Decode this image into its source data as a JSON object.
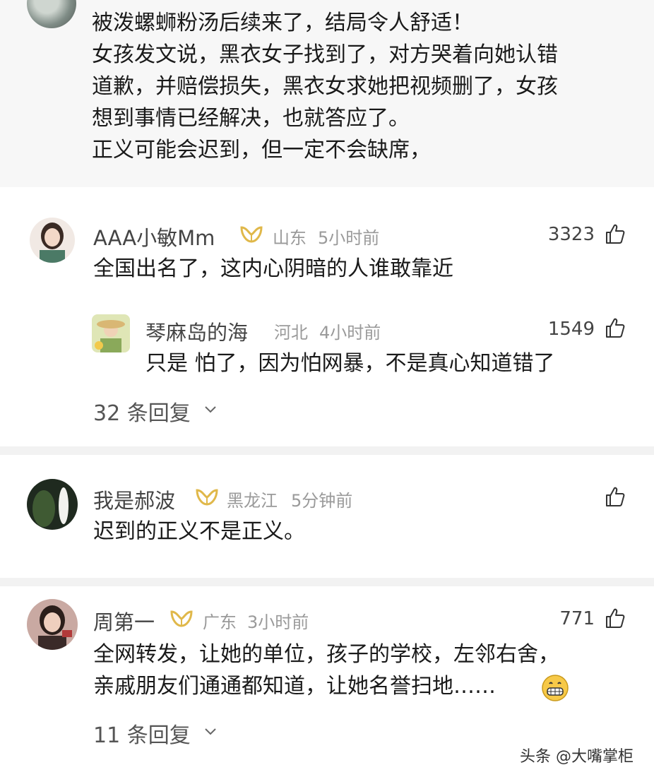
{
  "post": {
    "lines": [
      "被泼螺蛳粉汤后续来了，结局令人舒适！",
      "女孩发文说，黑衣女子找到了，对方哭着向她认错",
      "道歉，并赔偿损失，黑衣女求她把视频删了，女孩",
      "想到事情已经解决，也就答应了。",
      "正义可能会迟到，但一定不会缺席，"
    ]
  },
  "comments": [
    {
      "username": "AAA小敏Mm",
      "location": "山东",
      "time": "5小时前",
      "likes": "3323",
      "text": "全国出名了，这内心阴暗的人谁敢靠近",
      "reply": {
        "username": "琴麻岛的海",
        "location": "河北",
        "time": "4小时前",
        "likes": "1549",
        "text": "只是 怕了，因为怕网暴，不是真心知道错了"
      },
      "reply_count": "32 条回复"
    },
    {
      "username": "我是郝波",
      "location": "黑龙江",
      "time": "5分钟前",
      "text": "迟到的正义不是正义。"
    },
    {
      "username": "周第一",
      "location": "广东",
      "time": "3小时前",
      "likes": "771",
      "text_lines": [
        "全网转发，让她的单位，孩子的学校，左邻右舍，",
        "亲戚朋友们通通都知道，让她名誉扫地……"
      ],
      "reply_count": "11 条回复"
    }
  ],
  "watermark": "头条 @大嘴掌柜",
  "colors": {
    "vip_gold": "#e0b84a",
    "meta_gray": "#9a9a9a",
    "emoji_yellow": "#f7c948"
  },
  "icons": [
    "thumbs-up-icon",
    "chevron-down-icon",
    "vip-badge-icon",
    "grinning-emoji-icon"
  ]
}
